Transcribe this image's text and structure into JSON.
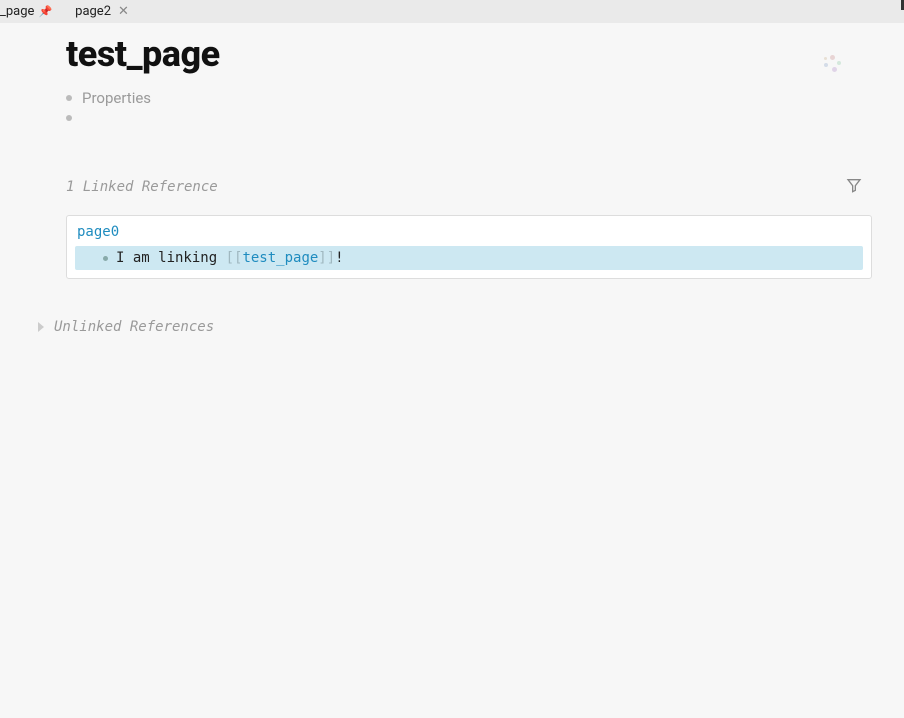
{
  "tabs": {
    "pinned": {
      "label_suffix": "_page"
    },
    "second": {
      "label": "page2"
    }
  },
  "page": {
    "title": "test_page",
    "properties_label": "Properties"
  },
  "linked": {
    "header": "1 Linked Reference",
    "reference": {
      "source_page": "page0",
      "text_before": "I am linking ",
      "bracket_open": "[[",
      "link_target": "test_page",
      "bracket_close": "]]",
      "text_after": "!"
    }
  },
  "unlinked": {
    "header": "Unlinked References"
  }
}
